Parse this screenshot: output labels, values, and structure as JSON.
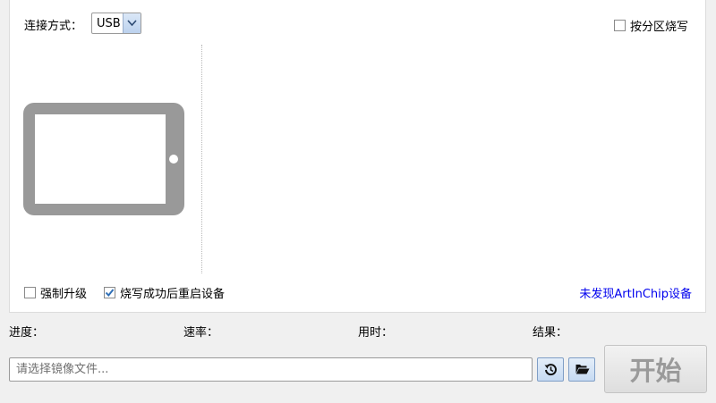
{
  "connection": {
    "label": "连接方式：",
    "selected": "USB"
  },
  "options": {
    "partition_burn": "按分区烧写",
    "partition_burn_checked": false,
    "force_upgrade": "强制升级",
    "force_upgrade_checked": false,
    "reboot_after": "烧写成功后重启设备",
    "reboot_after_checked": true
  },
  "device": {
    "icon": "tablet-icon",
    "status": "未发现ArtInChip设备",
    "status_color": "#0000ee"
  },
  "stats": {
    "progress_label": "进度：",
    "speed_label": "速率：",
    "time_label": "用时：",
    "result_label": "结果："
  },
  "file": {
    "placeholder": "请选择镜像文件...",
    "value": ""
  },
  "buttons": {
    "history_icon": "history-icon",
    "open_icon": "folder-open-icon",
    "start": "开始"
  },
  "colors": {
    "panel_bg": "#ffffff",
    "window_bg": "#f0f0f0",
    "icon_gray": "#999999",
    "check_blue": "#2f6fb6"
  }
}
